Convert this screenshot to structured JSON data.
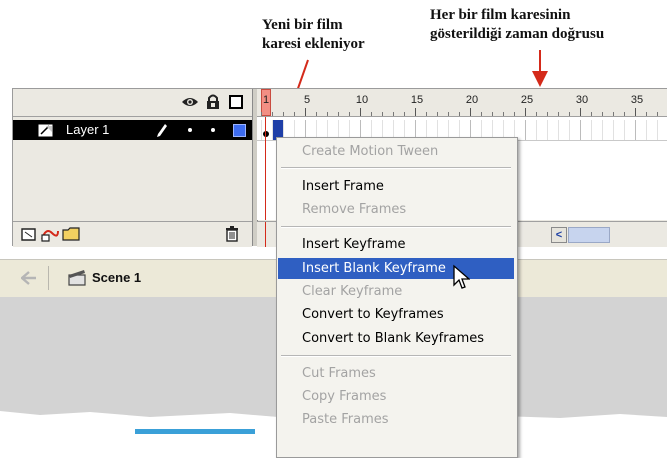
{
  "annotations": {
    "new_frame_line1": "Yeni bir film",
    "new_frame_line2": "karesi ekleniyor",
    "timeline_line1": "Her bir film karesinin",
    "timeline_line2": "gösterildiği zaman doğrusu"
  },
  "layers": {
    "name": "Layer 1"
  },
  "ruler": {
    "numbers": [
      "1",
      "5",
      "10",
      "15",
      "20",
      "25",
      "30",
      "35"
    ]
  },
  "scene": {
    "name": "Scene 1"
  },
  "context_menu": {
    "items": [
      {
        "label": "Create Motion Tween",
        "enabled": false
      },
      {
        "label": "Insert Frame",
        "enabled": true
      },
      {
        "label": "Remove Frames",
        "enabled": false
      },
      {
        "label": "Insert Keyframe",
        "enabled": true
      },
      {
        "label": "Insert Blank Keyframe",
        "enabled": true,
        "selected": true
      },
      {
        "label": "Clear Keyframe",
        "enabled": false
      },
      {
        "label": "Convert to Keyframes",
        "enabled": true
      },
      {
        "label": "Convert to Blank Keyframes",
        "enabled": true
      },
      {
        "label": "Cut Frames",
        "enabled": false
      },
      {
        "label": "Copy Frames",
        "enabled": false
      },
      {
        "label": "Paste Frames",
        "enabled": false
      }
    ]
  },
  "colors": {
    "accent_red": "#d42a1a",
    "menu_highlight": "#2f5fc2",
    "layer_selected": "#000000",
    "layer_color_swatch": "#3d6cf0"
  }
}
